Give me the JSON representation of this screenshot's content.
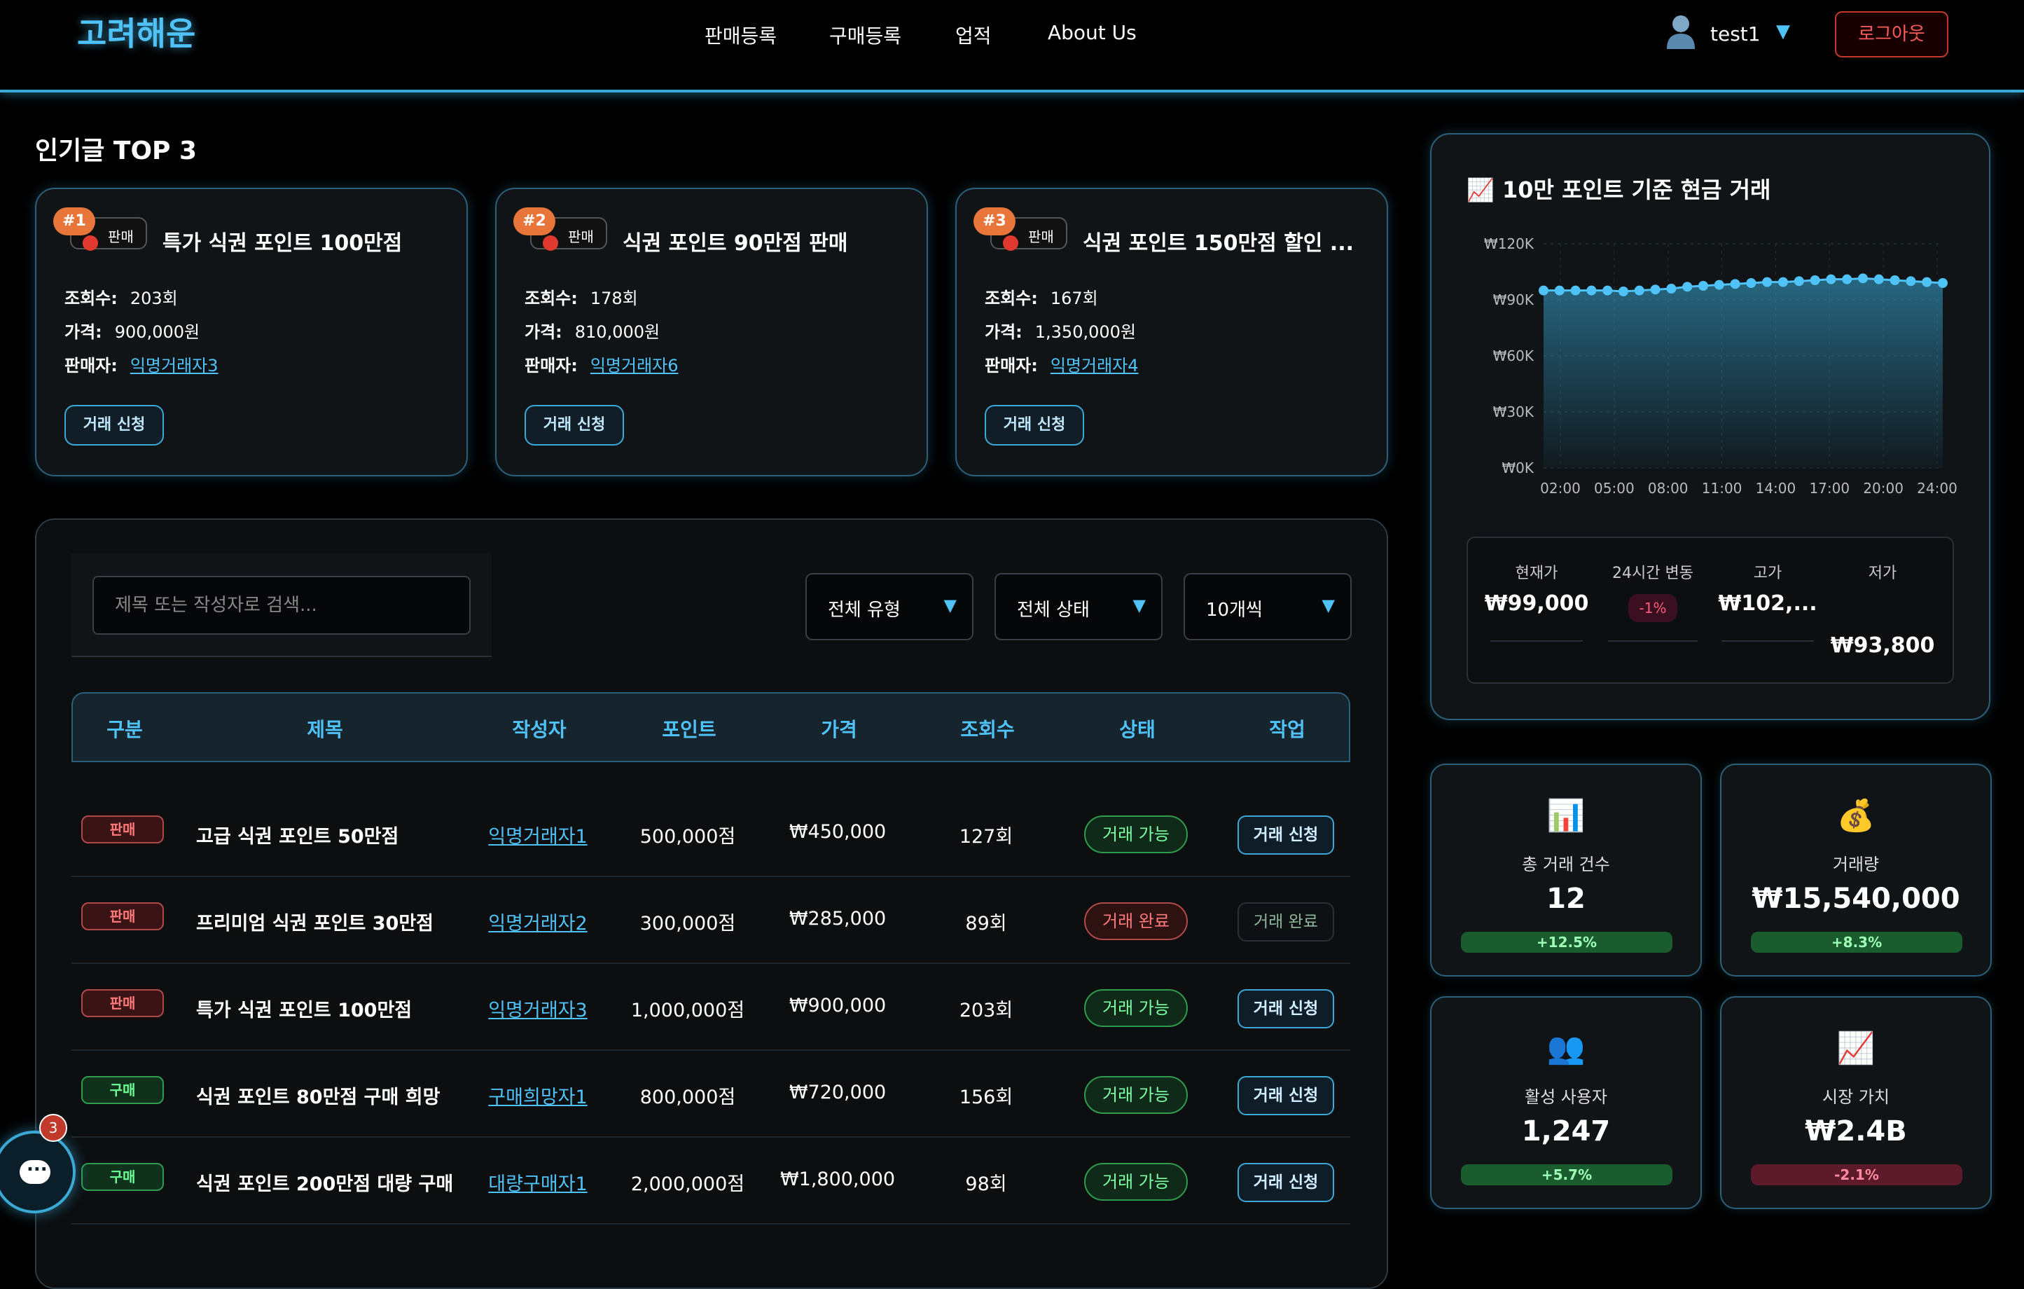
{
  "header": {
    "logo": "고려해운",
    "nav": [
      "판매등록",
      "구매등록",
      "업적",
      "About Us"
    ],
    "user": "test1",
    "logout": "로그아웃"
  },
  "top": {
    "title": "인기글 TOP 3",
    "cards": [
      {
        "rank": "#1",
        "type": "판매",
        "title": "특가 식권 포인트 100만점",
        "views_label": "조회수:",
        "views": "203회",
        "price_label": "가격:",
        "price": "900,000원",
        "seller_label": "판매자:",
        "seller": "익명거래자3",
        "button": "거래 신청"
      },
      {
        "rank": "#2",
        "type": "판매",
        "title": "식권 포인트 90만점 판매",
        "views_label": "조회수:",
        "views": "178회",
        "price_label": "가격:",
        "price": "810,000원",
        "seller_label": "판매자:",
        "seller": "익명거래자6",
        "button": "거래 신청"
      },
      {
        "rank": "#3",
        "type": "판매",
        "title": "식권 포인트 150만점 할인 ...",
        "views_label": "조회수:",
        "views": "167회",
        "price_label": "가격:",
        "price": "1,350,000원",
        "seller_label": "판매자:",
        "seller": "익명거래자4",
        "button": "거래 신청"
      }
    ]
  },
  "filters": {
    "search_placeholder": "제목 또는 작성자로 검색...",
    "type": "전체 유형",
    "status": "전체 상태",
    "per_page": "10개씩"
  },
  "table": {
    "headers": [
      "구분",
      "제목",
      "작성자",
      "포인트",
      "가격",
      "조회수",
      "상태",
      "작업"
    ],
    "rows": [
      {
        "type": "판매",
        "kind": "sell",
        "title": "고급 식권 포인트 50만점",
        "author": "익명거래자1",
        "points": "500,000점",
        "price": "₩450,000",
        "views": "127회",
        "status": "거래 가능",
        "state": "ok",
        "action": "거래 신청"
      },
      {
        "type": "판매",
        "kind": "sell",
        "title": "프리미엄 식권 포인트 30만점",
        "author": "익명거래자2",
        "points": "300,000점",
        "price": "₩285,000",
        "views": "89회",
        "status": "거래 완료",
        "state": "done",
        "action": "거래 완료"
      },
      {
        "type": "판매",
        "kind": "sell",
        "title": "특가 식권 포인트 100만점",
        "author": "익명거래자3",
        "points": "1,000,000점",
        "price": "₩900,000",
        "views": "203회",
        "status": "거래 가능",
        "state": "ok",
        "action": "거래 신청"
      },
      {
        "type": "구매",
        "kind": "buy",
        "title": "식권 포인트 80만점 구매 희망",
        "author": "구매희망자1",
        "points": "800,000점",
        "price": "₩720,000",
        "views": "156회",
        "status": "거래 가능",
        "state": "ok",
        "action": "거래 신청"
      },
      {
        "type": "구매",
        "kind": "buy",
        "title": "식권 포인트 200만점 대량 구매",
        "author": "대량구매자1",
        "points": "2,000,000점",
        "price": "₩1,800,000",
        "views": "98회",
        "status": "거래 가능",
        "state": "ok",
        "action": "거래 신청"
      }
    ]
  },
  "chart_data": {
    "type": "area",
    "title": "10만 포인트 기준 현금 거래",
    "y_ticks": [
      "₩120K",
      "₩90K",
      "₩60K",
      "₩30K",
      "₩0K"
    ],
    "x_ticks": [
      "02:00",
      "05:00",
      "08:00",
      "11:00",
      "14:00",
      "17:00",
      "20:00",
      "24:00"
    ],
    "ylim": [
      0,
      120000
    ],
    "values": [
      95000,
      95000,
      95000,
      95000,
      95000,
      94500,
      95000,
      95500,
      96000,
      97000,
      97500,
      98000,
      98500,
      99000,
      99500,
      99500,
      100000,
      100500,
      101000,
      101000,
      101500,
      101000,
      100500,
      100000,
      99500,
      99000
    ],
    "line_color": "#4fc3f7",
    "grid": true
  },
  "price_stats": {
    "current_label": "현재가",
    "current": "₩99,000",
    "change_label": "24시간 변동",
    "change": "-1%",
    "high_label": "고가",
    "high": "₩102,...",
    "low_label": "저가",
    "low": "₩93,800"
  },
  "metrics": [
    {
      "icon": "bar-chart-icon",
      "glyph": "📊",
      "label": "총 거래 건수",
      "value": "12",
      "change": "+12.5%",
      "dir": "up"
    },
    {
      "icon": "money-bag-icon",
      "glyph": "💰",
      "label": "거래량",
      "value": "₩15,540,000",
      "change": "+8.3%",
      "dir": "up"
    },
    {
      "icon": "users-icon",
      "glyph": "👥",
      "label": "활성 사용자",
      "value": "1,247",
      "change": "+5.7%",
      "dir": "up"
    },
    {
      "icon": "trend-icon",
      "glyph": "📈",
      "label": "시장 가치",
      "value": "₩2.4B",
      "change": "-2.1%",
      "dir": "down"
    }
  ],
  "chat": {
    "badge": "3"
  },
  "colors": {
    "accent": "#4fc3f7",
    "success": "#2e9b4f",
    "danger": "#c0392b"
  }
}
